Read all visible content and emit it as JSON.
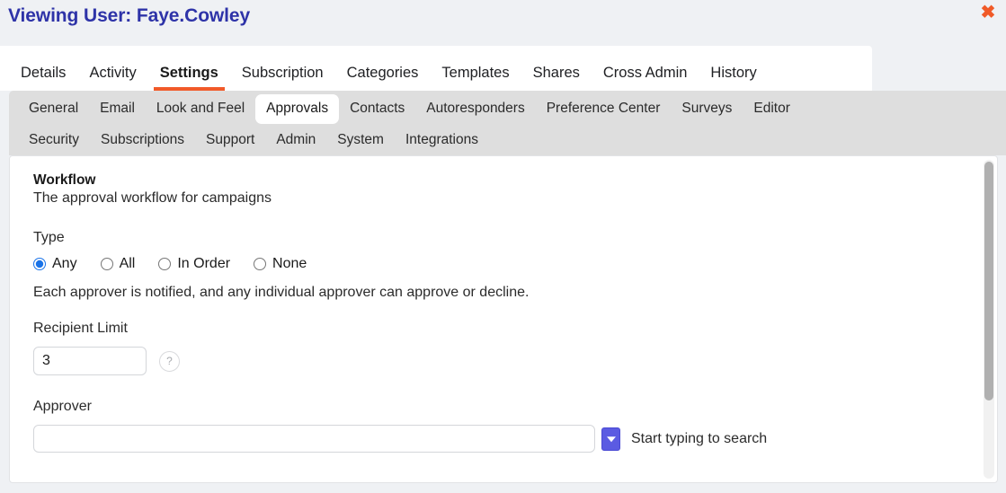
{
  "header": {
    "title": "Viewing User: Faye.Cowley",
    "close_label": "✖",
    "title_color": "#2e33a8",
    "close_color": "#f05a28"
  },
  "tabs": {
    "active": "Settings",
    "items": [
      {
        "label": "Details"
      },
      {
        "label": "Activity"
      },
      {
        "label": "Settings"
      },
      {
        "label": "Subscription"
      },
      {
        "label": "Categories"
      },
      {
        "label": "Templates"
      },
      {
        "label": "Shares"
      },
      {
        "label": "Cross Admin"
      },
      {
        "label": "History"
      }
    ],
    "active_underline_color": "#f15a29"
  },
  "subtabs": {
    "active": "Approvals",
    "row1": [
      {
        "label": "General"
      },
      {
        "label": "Email"
      },
      {
        "label": "Look and Feel"
      },
      {
        "label": "Approvals"
      },
      {
        "label": "Contacts"
      },
      {
        "label": "Autoresponders"
      },
      {
        "label": "Preference Center"
      },
      {
        "label": "Surveys"
      },
      {
        "label": "Editor"
      }
    ],
    "row2": [
      {
        "label": "Security"
      },
      {
        "label": "Subscriptions"
      },
      {
        "label": "Support"
      },
      {
        "label": "Admin"
      },
      {
        "label": "System"
      },
      {
        "label": "Integrations"
      }
    ]
  },
  "workflow": {
    "title": "Workflow",
    "subtitle": "The approval workflow for campaigns",
    "type_label": "Type",
    "type_options": [
      {
        "label": "Any",
        "selected": true
      },
      {
        "label": "All",
        "selected": false
      },
      {
        "label": "In Order",
        "selected": false
      },
      {
        "label": "None",
        "selected": false
      }
    ],
    "type_help": "Each approver is notified, and any individual approver can approve or decline.",
    "recipient_limit_label": "Recipient Limit",
    "recipient_limit_value": "3",
    "recipient_limit_placeholder": "",
    "help_icon_label": "?",
    "approver_label": "Approver",
    "approver_value": "",
    "approver_placeholder": "",
    "approver_dropdown_hint": "Start typing to search",
    "dropdown_color": "#5b5be2",
    "radio_accent": "#1a73e8"
  }
}
